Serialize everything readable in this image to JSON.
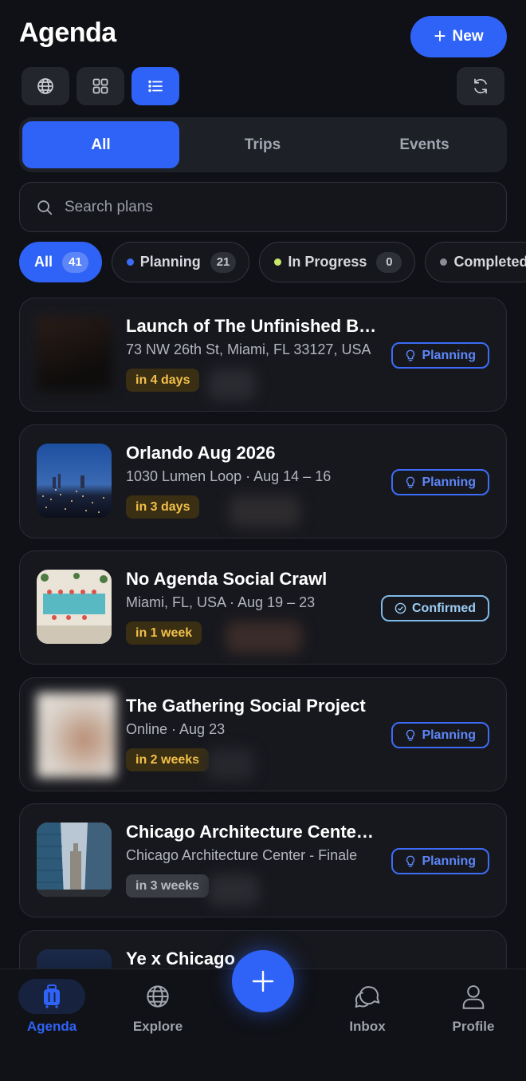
{
  "header": {
    "title": "Agenda",
    "new_label": "New"
  },
  "view_buttons": [
    {
      "icon": "globe-icon"
    },
    {
      "icon": "grid-icon"
    },
    {
      "icon": "list-icon"
    }
  ],
  "refresh_icon": "refresh-icon",
  "segments": [
    {
      "label": "All"
    },
    {
      "label": "Trips"
    },
    {
      "label": "Events"
    }
  ],
  "search": {
    "placeholder": "Search plans"
  },
  "filters": [
    {
      "label": "All",
      "count": "41"
    },
    {
      "label": "Planning",
      "count": "21",
      "dot_color": "#3c6cf6"
    },
    {
      "label": "In Progress",
      "count": "0",
      "dot_color": "#c8e76a"
    },
    {
      "label": "Completed",
      "dot_color": "#8a8d95"
    }
  ],
  "plans": [
    {
      "title": "Launch of The Unfinished Business",
      "subtitle": "73 NW 26th St, Miami, FL 33127, USA",
      "when": "in 4 days",
      "status": "Planning"
    },
    {
      "title": "Orlando Aug 2026",
      "subtitle": "1030 Lumen Loop · Aug 14 – 16",
      "when": "in 3 days",
      "status": "Planning"
    },
    {
      "title": "No Agenda Social Crawl",
      "subtitle": "Miami, FL, USA · Aug 19 – 23",
      "when": "in 1 week",
      "status": "Confirmed"
    },
    {
      "title": "The Gathering Social Project",
      "subtitle": "Online · Aug 23",
      "when": "in 2 weeks",
      "status": "Planning"
    },
    {
      "title": "Chicago Architecture Center Tour",
      "subtitle": "Chicago Architecture Center - Finale",
      "when": "in 3 weeks",
      "status": "Planning"
    },
    {
      "title": "Ye x Chicago"
    }
  ],
  "tabbar": {
    "agenda": "Agenda",
    "explore": "Explore",
    "inbox": "Inbox",
    "profile": "Profile"
  },
  "colors": {
    "accent": "#2f63f7",
    "background": "#101116",
    "warning_text": "#f2c04a"
  }
}
